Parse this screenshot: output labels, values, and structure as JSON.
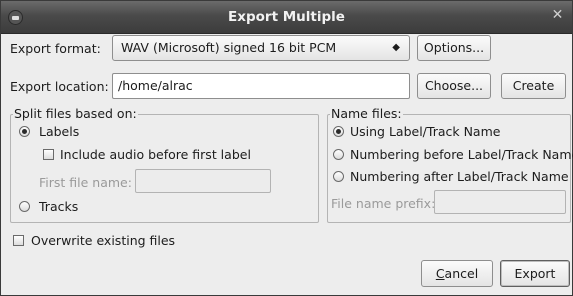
{
  "window": {
    "title": "Export Multiple",
    "close_glyph": "✕"
  },
  "export_format": {
    "label": "Export format:",
    "selected": "WAV (Microsoft) signed 16 bit PCM",
    "arrows": "◆",
    "options_button": "Options..."
  },
  "export_location": {
    "label": "Export location:",
    "value": "/home/alrac",
    "choose_button": "Choose...",
    "create_button": "Create"
  },
  "split": {
    "title": "Split files based on:",
    "labels_option": "Labels",
    "labels_selected": true,
    "include_audio": "Include audio before first label",
    "include_audio_checked": false,
    "first_file_label": "First file name:",
    "first_file_value": "",
    "tracks_option": "Tracks",
    "tracks_selected": false
  },
  "name_files": {
    "title": "Name files:",
    "options": [
      "Using Label/Track Name",
      "Numbering before Label/Track Name",
      "Numbering after Label/Track Name"
    ],
    "selected_index": 0,
    "prefix_label": "File name prefix:",
    "prefix_value": ""
  },
  "overwrite": {
    "label": "Overwrite existing files",
    "checked": false
  },
  "buttons": {
    "cancel_first": "C",
    "cancel_rest": "ancel",
    "export": "Export"
  },
  "icons": {
    "window_menu": "window-menu-icon",
    "close": "close-icon",
    "combo_arrows": "combo-arrows-icon"
  }
}
